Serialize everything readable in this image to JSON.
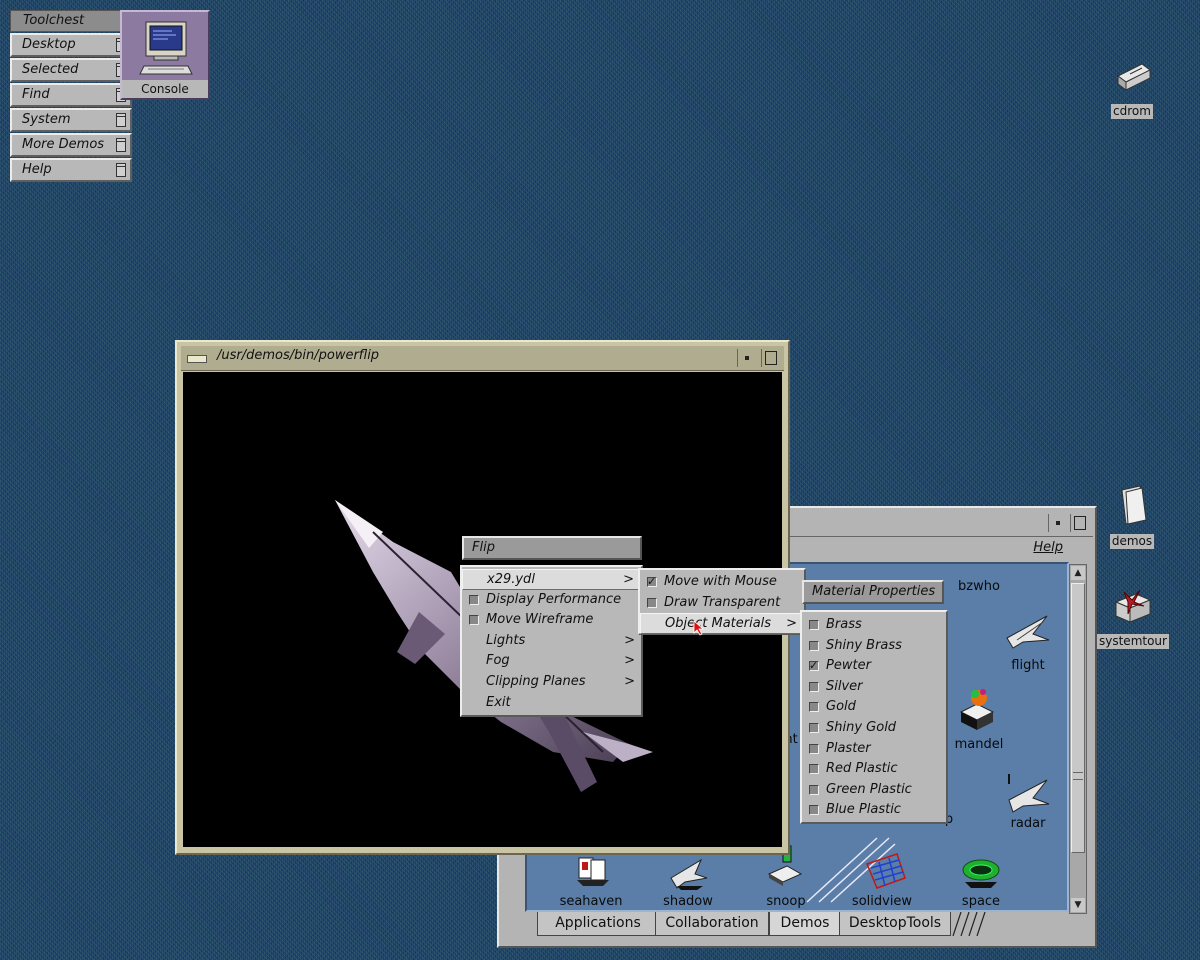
{
  "toolchest": {
    "title": "Toolchest",
    "items": [
      {
        "label": "Desktop"
      },
      {
        "label": "Selected"
      },
      {
        "label": "Find"
      },
      {
        "label": "System"
      },
      {
        "label": "More Demos"
      },
      {
        "label": "Help"
      }
    ]
  },
  "desktop_icons": {
    "console": "Console",
    "cdrom": "cdrom",
    "demos": "demos",
    "systemtour": "systemtour"
  },
  "powerflip_window": {
    "title": "/usr/demos/bin/powerflip"
  },
  "desktop_window": {
    "help": "Help",
    "icons": {
      "bzwho": "bzwho",
      "flight": "flight",
      "mandel": "mandel",
      "radar": "radar",
      "seahaven": "seahaven",
      "shadow": "shadow",
      "snoop": "snoop",
      "solidview": "solidview",
      "space": "space",
      "partial_nt": "nt",
      "partial_p": "p"
    },
    "tabs": [
      "Applications",
      "Collaboration",
      "Demos",
      "DesktopTools"
    ]
  },
  "flip_menu": {
    "title": "Flip",
    "items": [
      {
        "label": "x29.ydl",
        "submenu": true,
        "highlighted": true
      },
      {
        "label": "Display Performance",
        "checkbox": true,
        "checked": false
      },
      {
        "label": "Move Wireframe",
        "checkbox": true,
        "checked": false
      },
      {
        "label": "Lights",
        "submenu": true
      },
      {
        "label": "Fog",
        "submenu": true
      },
      {
        "label": "Clipping Planes",
        "submenu": true
      },
      {
        "label": "Exit"
      }
    ],
    "arrow": ">"
  },
  "object_submenu": {
    "items": [
      {
        "label": "Move with Mouse",
        "checkbox": true,
        "checked": true
      },
      {
        "label": "Draw Transparent",
        "checkbox": true,
        "checked": false
      },
      {
        "label": "Object Materials",
        "submenu": true,
        "highlighted": true
      }
    ]
  },
  "materials_menu": {
    "title": "Material Properties",
    "items": [
      {
        "label": "Brass",
        "checked": false
      },
      {
        "label": "Shiny Brass",
        "checked": false
      },
      {
        "label": "Pewter",
        "checked": true
      },
      {
        "label": "Silver",
        "checked": false
      },
      {
        "label": "Gold",
        "checked": false
      },
      {
        "label": "Shiny Gold",
        "checked": false
      },
      {
        "label": "Plaster",
        "checked": false
      },
      {
        "label": "Red Plastic",
        "checked": false
      },
      {
        "label": "Green Plastic",
        "checked": false
      },
      {
        "label": "Blue Plastic",
        "checked": false
      }
    ]
  }
}
